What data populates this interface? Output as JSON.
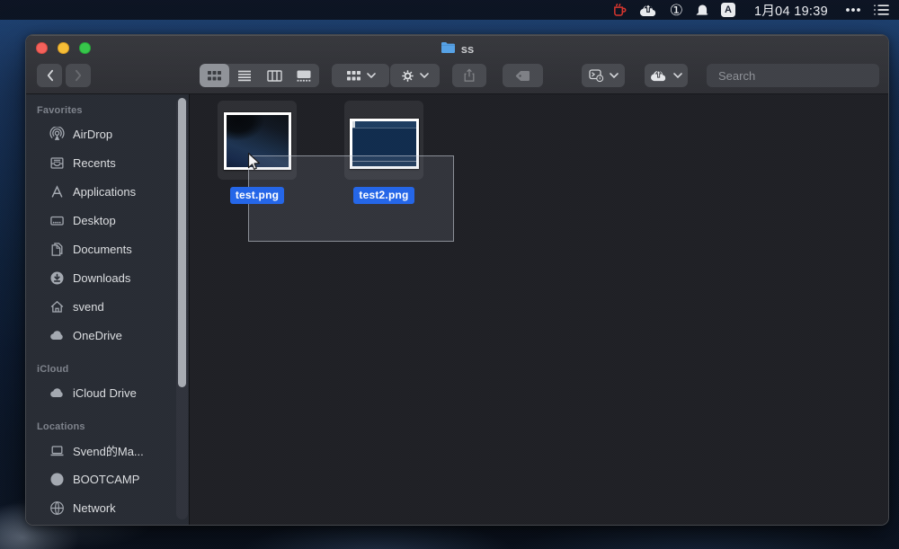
{
  "menubar": {
    "clock": "1月04 19:39",
    "input_source_label": "A",
    "status_icons": [
      {
        "id": "caffeine-mug",
        "color": "#d8342c"
      },
      {
        "id": "cloud-upload",
        "color": "#e9ebee"
      },
      {
        "id": "one-circle",
        "glyph": "①"
      },
      {
        "id": "cat-app",
        "color": "#e9ebee"
      },
      {
        "id": "input-source-a",
        "label": "A"
      },
      {
        "id": "more-dots",
        "color": "#e9ebee"
      },
      {
        "id": "list-menu",
        "color": "#e9ebee"
      }
    ]
  },
  "window": {
    "title": "ss",
    "toolbar": {
      "search_placeholder": "Search",
      "buttons": [
        "back",
        "forward",
        "icon-view",
        "list-view",
        "column-view",
        "gallery-view",
        "grouping",
        "action",
        "share",
        "tag",
        "quick-action",
        "cloud-sync",
        "search"
      ]
    },
    "sidebar": {
      "sections": [
        {
          "header": "Favorites",
          "items": [
            {
              "id": "airdrop",
              "label": "AirDrop",
              "icon": "airdrop-icon"
            },
            {
              "id": "recents",
              "label": "Recents",
              "icon": "recents-icon"
            },
            {
              "id": "applications",
              "label": "Applications",
              "icon": "applications-icon"
            },
            {
              "id": "desktop",
              "label": "Desktop",
              "icon": "desktop-icon"
            },
            {
              "id": "documents",
              "label": "Documents",
              "icon": "documents-icon"
            },
            {
              "id": "downloads",
              "label": "Downloads",
              "icon": "downloads-icon"
            },
            {
              "id": "svend",
              "label": "svend",
              "icon": "home-icon"
            },
            {
              "id": "onedrive",
              "label": "OneDrive",
              "icon": "cloud-icon"
            }
          ]
        },
        {
          "header": "iCloud",
          "items": [
            {
              "id": "icloud-drive",
              "label": "iCloud Drive",
              "icon": "cloud-icon"
            }
          ]
        },
        {
          "header": "Locations",
          "items": [
            {
              "id": "svend-mac",
              "label": "Svend的Ma...",
              "icon": "laptop-icon"
            },
            {
              "id": "bootcamp",
              "label": "BOOTCAMP",
              "icon": "disk-icon"
            },
            {
              "id": "network",
              "label": "Network",
              "icon": "globe-icon"
            }
          ]
        }
      ]
    },
    "files": [
      {
        "name": "test.png",
        "thumb": "photo-dark",
        "selected": true
      },
      {
        "name": "test2.png",
        "thumb": "screenshot-window",
        "selected": true
      }
    ],
    "colors": {
      "selection_label_bg": "#2365e8",
      "folder_blue": "#55a1e6",
      "toolbar_button": "#47494f"
    }
  }
}
